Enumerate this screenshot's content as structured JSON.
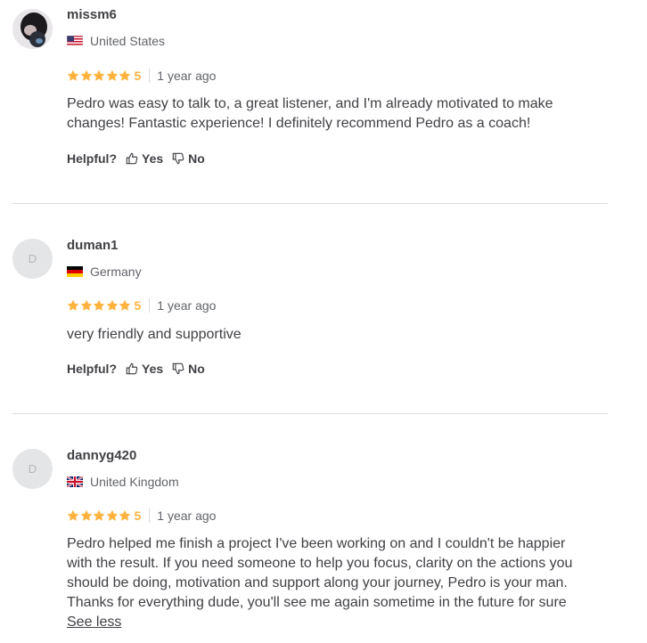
{
  "reviews": [
    {
      "username": "missm6",
      "avatar_letter": "",
      "country": "United States",
      "flag": "us",
      "rating": "5",
      "time": "1 year ago",
      "lines": [
        "Pedro was easy to talk to, a great listener, and I'm already motivated to make",
        "changes! Fantastic experience! I definitely recommend Pedro as a coach!"
      ],
      "helpful_label": "Helpful?",
      "yes_label": "Yes",
      "no_label": "No"
    },
    {
      "username": "duman1",
      "avatar_letter": "D",
      "country": "Germany",
      "flag": "de",
      "rating": "5",
      "time": "1 year ago",
      "lines": [
        "very friendly and supportive"
      ],
      "helpful_label": "Helpful?",
      "yes_label": "Yes",
      "no_label": "No"
    },
    {
      "username": "dannyg420",
      "avatar_letter": "D",
      "country": "United Kingdom",
      "flag": "gb",
      "rating": "5",
      "time": "1 year ago",
      "lines": [
        "Pedro helped me finish a project I've been working on and I couldn't be happier",
        "with the result. If you need someone to help you focus, clarity on the actions you",
        "should be doing, motivation and support along your journey, Pedro is your man.",
        "Thanks for everything dude, you'll see me again sometime in the future for sure"
      ],
      "see_less": "See less"
    }
  ],
  "colors": {
    "star": "#ffb33e",
    "text": "#404145",
    "muted": "#62646a",
    "divider": "#dadbdd"
  },
  "icons": {
    "star": "star-icon",
    "thumb_up": "thumb-up-icon",
    "thumb_down": "thumb-down-icon"
  }
}
